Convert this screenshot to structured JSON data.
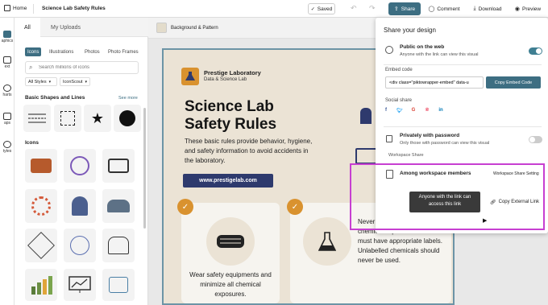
{
  "topbar": {
    "home": "Home",
    "title": "Science Lab Safety Rules",
    "saved": "Saved",
    "share": "Share",
    "comment": "Comment",
    "download": "Download",
    "preview": "Preview"
  },
  "rail": {
    "items": [
      "aphics",
      "ext",
      "harts",
      "aps",
      "tytes"
    ]
  },
  "panel": {
    "tabs": [
      "All",
      "My Uploads"
    ],
    "subtabs": [
      "Icons",
      "Illustrations",
      "Photos",
      "Photo Frames"
    ],
    "search_placeholder": "Search millions of icons",
    "filter1": "All Styles",
    "filter2": "IconScout",
    "section1": "Basic Shapes and Lines",
    "see_more": "See more",
    "section2": "Icons"
  },
  "canvas": {
    "bg_pattern": "Background & Pattern"
  },
  "design": {
    "brand_name": "Prestige Laboratory",
    "brand_sub": "Data & Science Lab",
    "title_line1": "Science Lab",
    "title_line2": "Safety Rules",
    "body": "These basic rules provide behavior, hygiene, and safety information to avoid accidents in the laboratory.",
    "url": "www.prestigelab.com",
    "card1": "Wear safety equipments and minimize all chemical exposures.",
    "card2": "Never leave containers of chemicals open. All containers must have appropriate labels. Unlabelled chemicals should never be used."
  },
  "share_panel": {
    "heading": "Share your design",
    "public_title": "Public on the web",
    "public_sub": "Anyone with the link can view this visual",
    "embed_label": "Embed code",
    "embed_value": "<div class=\"piktowrapper-embed\" data-u",
    "embed_button": "Copy Embed Code",
    "social_label": "Social share",
    "social": [
      "f",
      "Twitter",
      "G",
      "Pinterest",
      "in"
    ],
    "private_title": "Privately with password",
    "private_sub": "Only those with password can view this visual",
    "workspace_label": "Workspace Share",
    "workspace_title": "Among workspace members",
    "workspace_settings": "Workspace Share Setting",
    "tooltip": "Anyone with the link can access this link",
    "copy_external": "Copy External Link"
  },
  "colors": {
    "share_btn": "#3d6e82",
    "highlight": "#c73fd1",
    "toggle_on": "#3f7f92",
    "navy": "#2e3a6d",
    "orange": "#d9922f"
  }
}
